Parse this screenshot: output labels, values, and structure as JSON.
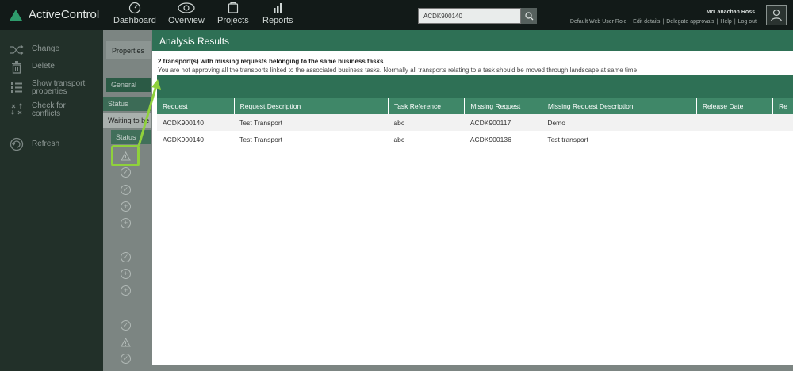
{
  "app": {
    "title": "ActiveControl"
  },
  "nav": [
    {
      "label": "Dashboard",
      "icon": "dashboard-gauge-icon"
    },
    {
      "label": "Overview",
      "icon": "eye-icon"
    },
    {
      "label": "Projects",
      "icon": "projects-icon"
    },
    {
      "label": "Reports",
      "icon": "bar-chart-icon"
    }
  ],
  "search": {
    "value": "ACDK900140"
  },
  "user": {
    "name": "McLanachan Ross",
    "links": [
      "Default Web User Role",
      "|",
      "Edit details",
      "|",
      "Delegate approvals",
      "|",
      "Help",
      "|",
      "Log out"
    ]
  },
  "sidebar": {
    "items": [
      {
        "label": "Change",
        "icon": "shuffle-icon"
      },
      {
        "label": "Delete",
        "icon": "trash-icon"
      },
      {
        "label": "Show transport properties",
        "icon": "list-icon"
      },
      {
        "label": "Check for conflicts",
        "icon": "conflicts-icon"
      },
      {
        "label": "Refresh",
        "icon": "refresh-icon"
      }
    ]
  },
  "background": {
    "properties_tab": "Properties",
    "general_tab": "General",
    "status_header": "Status",
    "status_value": "Waiting to be",
    "status_column": "Status"
  },
  "modal": {
    "title": "Analysis Results",
    "message_title": "2 transport(s) with missing requests belonging to the same business tasks",
    "message_body": "You are not approving all the transports linked to the associated business tasks. Normally all transports relating to a task should be moved through landscape at same time",
    "columns": [
      "Request",
      "Request Description",
      "Task Reference",
      "Missing Request",
      "Missing Request Description",
      "Release Date",
      "Re"
    ],
    "rows": [
      [
        "ACDK900140",
        "Test Transport",
        "abc",
        "ACDK900117",
        "Demo",
        "",
        ""
      ],
      [
        "ACDK900140",
        "Test Transport",
        "abc",
        "ACDK900136",
        "Test transport",
        "",
        ""
      ]
    ]
  },
  "colors": {
    "accent_green": "#2e7055",
    "header_green": "#3f8768",
    "highlight_green": "#8fd13c",
    "topbar": "#121a18",
    "sidebar": "#223029"
  }
}
